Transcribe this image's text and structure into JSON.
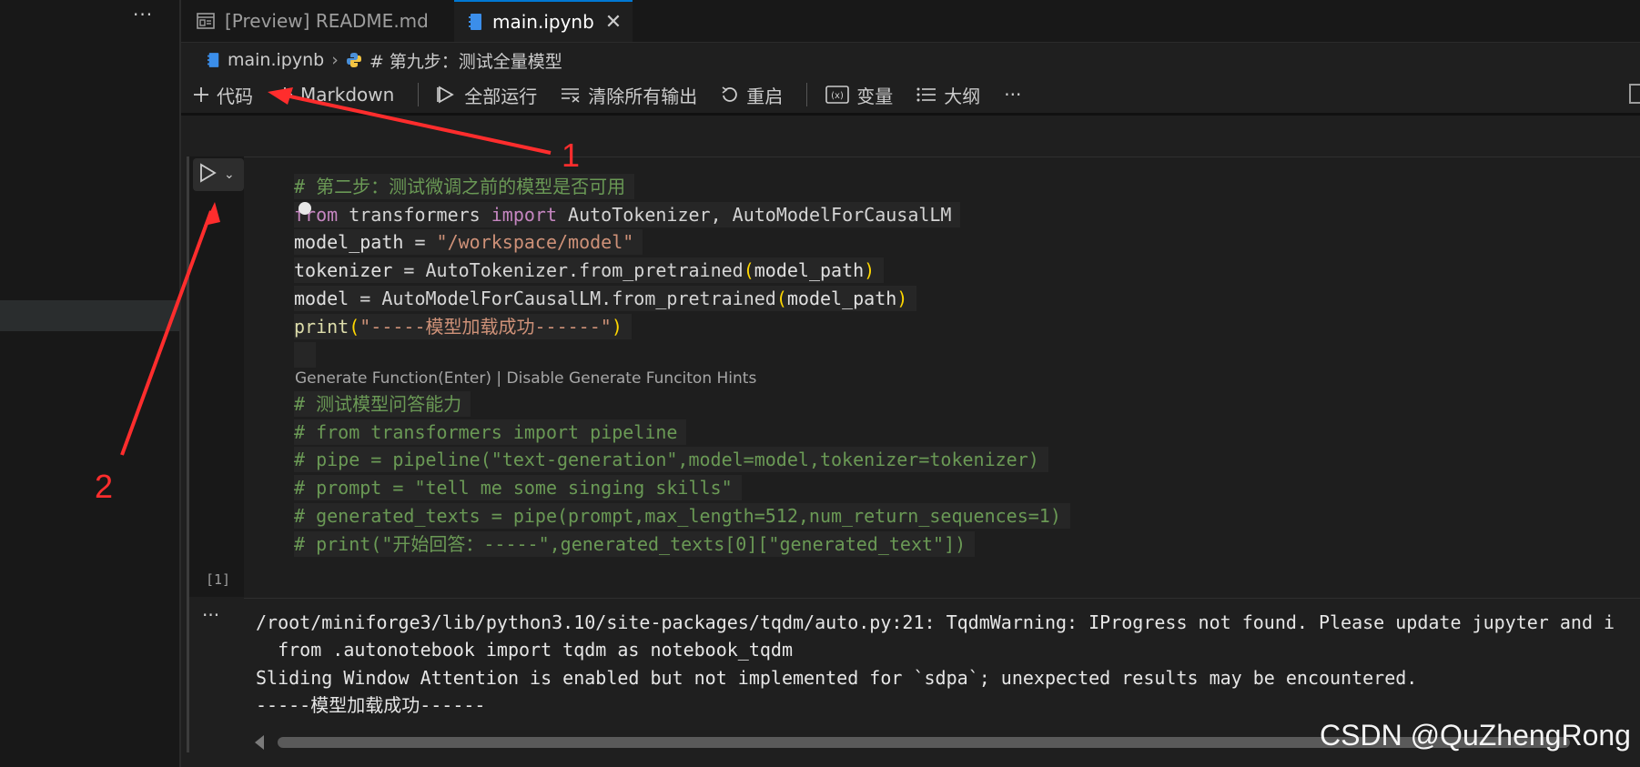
{
  "left_panel": {
    "more_label": "···"
  },
  "tabs": [
    {
      "label": "[Preview] README.md",
      "active": false
    },
    {
      "label": "main.ipynb",
      "active": true,
      "close": "✕"
    }
  ],
  "breadcrumb": {
    "file": "main.ipynb",
    "separator": "›",
    "section": "# 第九步：测试全量模型"
  },
  "toolbar": {
    "add_code": "代码",
    "add_markdown": "Markdown",
    "run_all": "全部运行",
    "clear_outputs": "清除所有输出",
    "restart": "重启",
    "variables": "变量",
    "outline": "大纲",
    "more": "···"
  },
  "cell": {
    "execution_count": "[1]",
    "hint": "Generate Function(Enter) | Disable Generate Funciton Hints",
    "code": {
      "l1": "# 第二步：测试微调之前的模型是否可用",
      "l2_kw1": "from",
      "l2_mod": " transformers ",
      "l2_kw2": "import",
      "l2_cls": " AutoTokenizer, AutoModelForCausalLM",
      "l3_var": "model_path",
      "l3_op": " = ",
      "l3_str": "\"/workspace/model\"",
      "l4_var": "tokenizer",
      "l4_op": " = ",
      "l4_cls": "AutoTokenizer",
      "l4_fn": ".from_pretrained",
      "l4_open": "(",
      "l4_arg": "model_path",
      "l4_close": ")",
      "l5_var": "model",
      "l5_op": " = ",
      "l5_cls": "AutoModelForCausalLM",
      "l5_fn": ".from_pretrained",
      "l5_open": "(",
      "l5_arg": "model_path",
      "l5_close": ")",
      "l6_fn": "print",
      "l6_open": "(",
      "l6_str": "\"-----模型加载成功------\"",
      "l6_close": ")",
      "l8": "# 测试模型问答能力",
      "l9": "# from transformers import pipeline",
      "l10": "# pipe = pipeline(\"text-generation\",model=model,tokenizer=tokenizer)",
      "l11": "# prompt = \"tell me some singing skills\"",
      "l12": "# generated_texts = pipe(prompt,max_length=512,num_return_sequences=1)",
      "l13": "# print(\"开始回答：-----\",generated_texts[0][\"generated_text\"])"
    }
  },
  "output": {
    "more_label": "···",
    "lines": [
      "/root/miniforge3/lib/python3.10/site-packages/tqdm/auto.py:21: TqdmWarning: IProgress not found. Please update jupyter and i",
      "  from .autonotebook import tqdm as notebook_tqdm",
      "Sliding Window Attention is enabled but not implemented for `sdpa`; unexpected results may be encountered.",
      "-----模型加载成功------"
    ]
  },
  "annotations": {
    "one": "1",
    "two": "2",
    "color": "#ff2d2d"
  },
  "watermark": "CSDN @QuZhengRong",
  "colors": {
    "accent": "#0078d4",
    "comment": "#6a9955",
    "keyword": "#c586c0",
    "string": "#ce9178",
    "class": "#4ec9b0"
  },
  "icons": [
    "preview-icon",
    "notebook-icon",
    "python-icon",
    "plus-icon",
    "run-all-icon",
    "clear-outputs-icon",
    "restart-icon",
    "variables-icon",
    "outline-icon",
    "run-cell-icon",
    "chevron-down-icon",
    "close-icon"
  ]
}
